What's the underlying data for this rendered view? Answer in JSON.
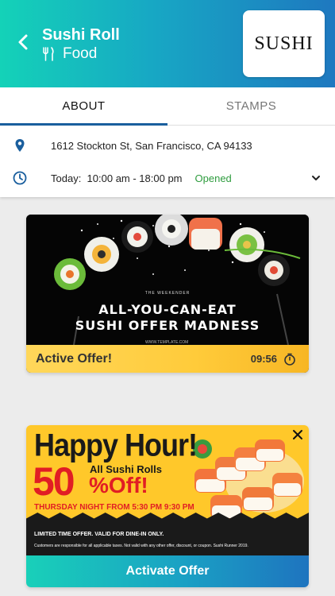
{
  "header": {
    "title": "Sushi Roll",
    "category": "Food",
    "logo_text": "SUSHI"
  },
  "tabs": [
    {
      "label": "ABOUT",
      "active": true
    },
    {
      "label": "STAMPS",
      "active": false
    }
  ],
  "info": {
    "address": "1612 Stockton St, San Francisco, CA 94133",
    "hours_label": "Today:",
    "hours_value": "10:00 am - 18:00 pm",
    "status": "Opened"
  },
  "offer1": {
    "kicker": "THE WEEKENDER",
    "headline_line1": "ALL-YOU-CAN-EAT",
    "headline_line2": "SUSHI OFFER MADNESS",
    "website": "WWW.TEMPLATE.COM",
    "status_label": "Active Offer!",
    "timer": "09:56"
  },
  "offer2": {
    "happy_hour": "Happy Hour!",
    "percent": "50",
    "all_sushi": "All Sushi Rolls",
    "percent_off": "%Off!",
    "schedule": "THURSDAY NIGHT FROM 5:30 PM 9:30 PM",
    "limited": "LIMITED TIME OFFER. VALID FOR DINE-IN ONLY.",
    "disclaimer": "Customers are responsible for all applicable taxes. Not valid with any other offer, discount, or coupon. Sushi Runner 2019.",
    "button_label": "Activate Offer"
  },
  "colors": {
    "header_gradient_start": "#14d2b8",
    "header_gradient_end": "#1e78c0",
    "tab_indicator": "#1a5f9e",
    "opened_status": "#2e9c3e",
    "offer_bar": "#ffcb3a",
    "icon_blue": "#1a5f9e"
  }
}
